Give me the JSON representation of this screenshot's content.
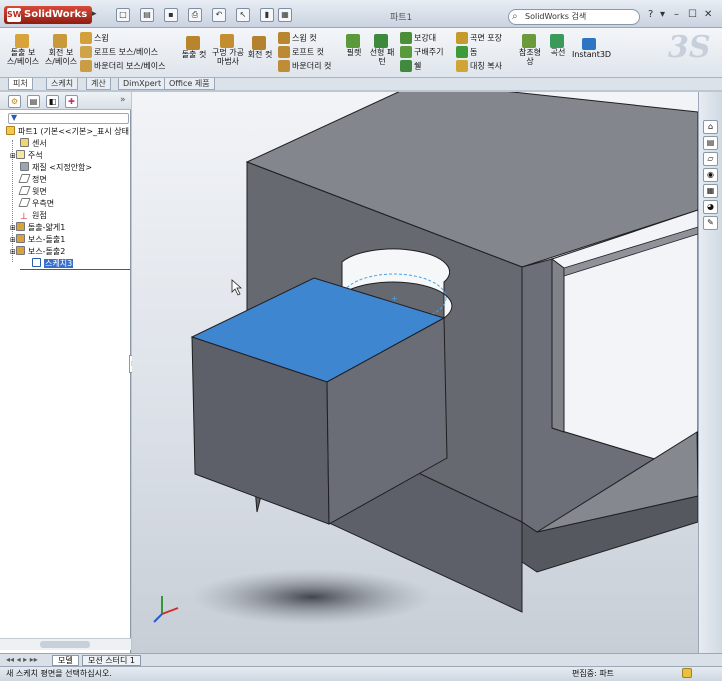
{
  "app": {
    "name": "SolidWorks",
    "logo_mark": "SW",
    "document_title": "파트1",
    "search_placeholder": "SolidWorks 검색",
    "window_controls": [
      "?",
      "▾",
      "–",
      "☐",
      "✕"
    ]
  },
  "quick_access": [
    "new-icon",
    "open-icon",
    "save-icon",
    "print-icon",
    "undo-icon",
    "select-icon",
    "rebuild-icon",
    "options-icon"
  ],
  "command_manager": {
    "large_buttons": [
      {
        "label": "돌출 보스/베이스",
        "icon": "extruded-boss-icon"
      },
      {
        "label": "회전 보스/베이스",
        "icon": "revolved-boss-icon"
      },
      {
        "label": "돌출 컷",
        "icon": "extruded-cut-icon"
      },
      {
        "label": "구멍 가공 마법사",
        "icon": "hole-wizard-icon"
      },
      {
        "label": "회전 컷",
        "icon": "revolved-cut-icon"
      },
      {
        "label": "필렛",
        "icon": "fillet-icon"
      },
      {
        "label": "선형 패턴",
        "icon": "linear-pattern-icon"
      },
      {
        "label": "참조형상",
        "icon": "reference-geometry-icon"
      },
      {
        "label": "곡선",
        "icon": "curves-icon"
      },
      {
        "label": "Instant3D",
        "icon": "instant3d-icon"
      }
    ],
    "small_buttons_group1": [
      "스윕",
      "로프트 보스/베이스",
      "바운더리 보스/베이스"
    ],
    "small_buttons_group2": [
      "스윕 컷",
      "로프트 컷",
      "바운더리 컷"
    ],
    "small_buttons_group3": [
      "보강대",
      "구배주기",
      "쉘"
    ],
    "small_buttons_group4": [
      "곡면 포장",
      "돔",
      "대칭 복사"
    ]
  },
  "tabs": [
    "피처",
    "스케치",
    "계산",
    "DimXpert",
    "Office 제품"
  ],
  "feature_tree": {
    "root": "파트1  (기본<<기본>_표시 상태",
    "items": [
      {
        "label": "센서",
        "icon": "sensor-icon"
      },
      {
        "label": "주석",
        "icon": "annotation-icon"
      },
      {
        "label": "재질 <지정안함>",
        "icon": "material-icon"
      },
      {
        "label": "정면",
        "icon": "plane-icon"
      },
      {
        "label": "윗면",
        "icon": "plane-icon"
      },
      {
        "label": "우측면",
        "icon": "plane-icon"
      },
      {
        "label": "원점",
        "icon": "origin-icon"
      },
      {
        "label": "돌출-얇게1",
        "icon": "feature-icon"
      },
      {
        "label": "보스-돌출1",
        "icon": "feature-icon"
      },
      {
        "label": "보스-돌출2",
        "icon": "feature-icon"
      },
      {
        "label": "스케치3",
        "icon": "sketch-icon",
        "selected": true
      }
    ]
  },
  "bottom_tabs": [
    "모델",
    "모션 스터디 1"
  ],
  "status": {
    "left": "새 스케치 평면을 선택하십시오.",
    "right": "편집중: 파트"
  },
  "colors": {
    "selected_face": "#3f86d0",
    "model_face_dark": "#5d6068",
    "model_face_mid": "#6c6f77",
    "model_face_light": "#84878e",
    "sketch_circle": "#4aa3e8"
  }
}
